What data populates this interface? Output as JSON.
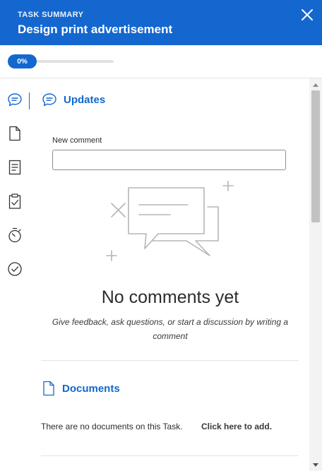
{
  "header": {
    "eyebrow": "TASK SUMMARY",
    "title": "Design print advertisement",
    "background_color": "#1467cf"
  },
  "progress": {
    "label": "0%",
    "value": 0
  },
  "rail": {
    "items": [
      "comment-icon",
      "document-icon",
      "notes-icon",
      "clipboard-check-icon",
      "timer-icon",
      "check-circle-icon"
    ],
    "active": "comment-icon"
  },
  "updates": {
    "heading": "Updates",
    "new_comment_label": "New comment",
    "new_comment_value": "",
    "empty_title": "No comments yet",
    "empty_description": "Give feedback, ask questions, or start a discussion by writing a comment"
  },
  "documents": {
    "heading": "Documents",
    "empty_text": "There are no documents on this Task.",
    "add_link": "Click here to add."
  }
}
